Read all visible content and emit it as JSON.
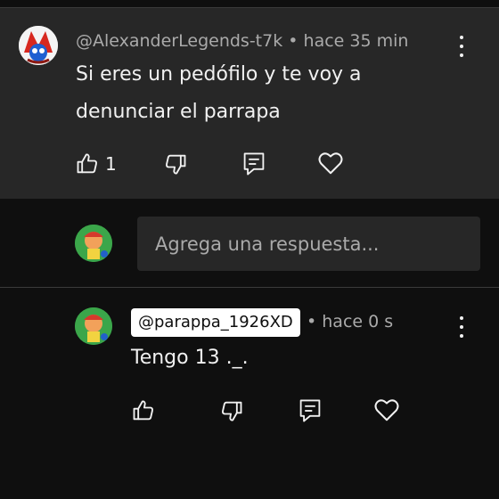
{
  "main_comment": {
    "username": "@AlexanderLegends-t7k",
    "separator": "•",
    "time": "hace 35 min",
    "text_line1": "Si eres un pedófilo y te voy a",
    "text_line2": "denunciar el parrapa",
    "like_count": "1"
  },
  "reply_input": {
    "placeholder": "Agrega una respuesta..."
  },
  "reply_comment": {
    "username": "@parappa_1926XD",
    "separator": "•",
    "time": "hace 0 s",
    "text": "Tengo 13 ._."
  },
  "colors": {
    "background": "#0f0f0f",
    "comment_highlight": "#272727",
    "meta_text": "#aaaaaa",
    "username_chip_bg": "#ffffff"
  },
  "icons": [
    "like-icon",
    "dislike-icon",
    "reply-icon",
    "heart-icon",
    "more-options-icon"
  ]
}
